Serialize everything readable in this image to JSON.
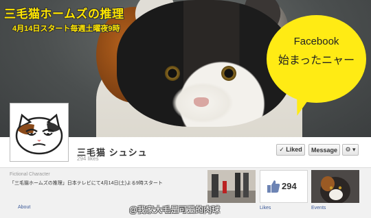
{
  "cover": {
    "title": "三毛猫ホームズの推理",
    "airtime": "4月14日スタート毎週土曜夜9時",
    "bubble": {
      "line1": "Facebook",
      "line2": "始まったニャー"
    }
  },
  "page": {
    "name": "三毛猫 シュシュ",
    "likes_text": "294 likes"
  },
  "buttons": {
    "liked": "✓ Liked",
    "message": "Message",
    "gear": "⚙ ▾"
  },
  "info": {
    "category": "Fictional Character",
    "description": "「三毛猫ホームズの推理」日本テレビにて4月14日(土)よる9時スタート",
    "about": "About"
  },
  "apps": {
    "likes_number": "294",
    "likes_label": "Likes",
    "events_label": "Events"
  },
  "watermark": "@我家大毛是可爱的肉球",
  "colors": {
    "title_yellow": "#ffe600",
    "bubble_yellow": "#ffeb14",
    "link_blue": "#3b5998",
    "like_blue": "#6d84b4"
  },
  "icons": {
    "thumbs_up": "thumbs-up-icon",
    "check": "check-icon",
    "gear": "gear-icon"
  }
}
